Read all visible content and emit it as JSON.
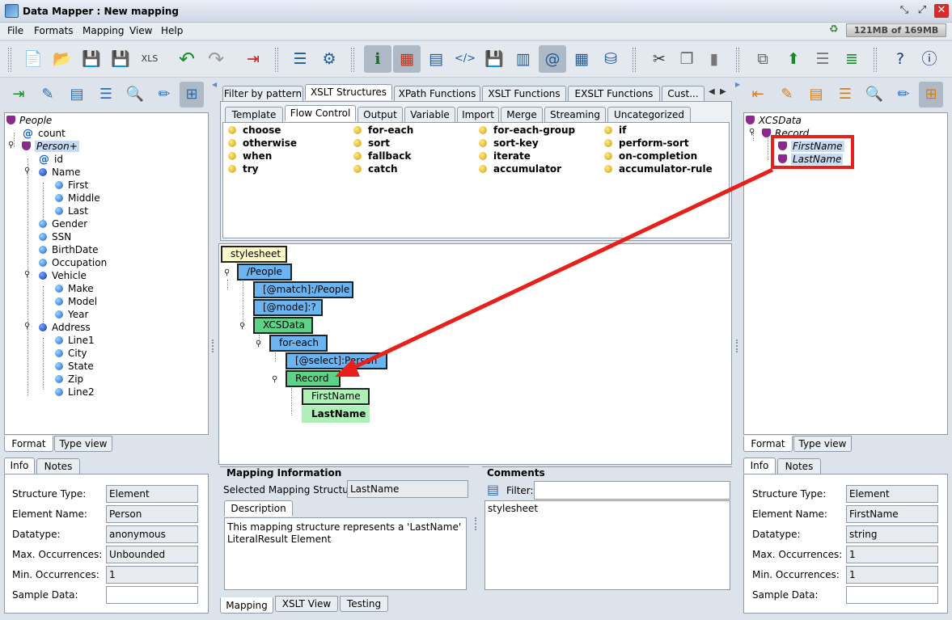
{
  "window": {
    "title": "Data Mapper : New mapping"
  },
  "menu": [
    "File",
    "Formats",
    "Mapping",
    "View",
    "Help"
  ],
  "memory": "121MB of 169MB",
  "toolbar_icons": [
    "new-mapping-icon",
    "open-icon",
    "save-icon",
    "save-as-icon",
    "export-xls-icon",
    "undo-icon",
    "redo-icon",
    "exit-icon",
    "generate-icon",
    "settings-icon",
    "info-icon",
    "palette-icon",
    "list-icon",
    "code-icon",
    "save-transform-icon",
    "document-icon",
    "at-icon",
    "table-icon",
    "database-icon",
    "cut-icon",
    "copy-icon",
    "paste-icon",
    "move-icon",
    "upload-icon",
    "align-icon",
    "stack-icon",
    "help-icon",
    "about-icon"
  ],
  "left_tree": {
    "items": [
      {
        "label": "People",
        "icon": "shield-icon"
      },
      {
        "label": "count",
        "icon": "attribute-icon"
      },
      {
        "label": "Person+",
        "icon": "shield-icon"
      },
      {
        "label": "id",
        "icon": "attribute-icon"
      },
      {
        "label": "Name",
        "icon": "element-icon"
      },
      {
        "label": "First",
        "icon": "element-icon"
      },
      {
        "label": "Middle",
        "icon": "element-icon"
      },
      {
        "label": "Last",
        "icon": "element-icon"
      },
      {
        "label": "Gender",
        "icon": "element-icon"
      },
      {
        "label": "SSN",
        "icon": "element-icon"
      },
      {
        "label": "BirthDate",
        "icon": "element-icon"
      },
      {
        "label": "Occupation",
        "icon": "element-icon"
      },
      {
        "label": "Vehicle",
        "icon": "element-icon"
      },
      {
        "label": "Make",
        "icon": "element-icon"
      },
      {
        "label": "Model",
        "icon": "element-icon"
      },
      {
        "label": "Year",
        "icon": "element-icon"
      },
      {
        "label": "Address",
        "icon": "element-icon"
      },
      {
        "label": "Line1",
        "icon": "element-icon"
      },
      {
        "label": "City",
        "icon": "element-icon"
      },
      {
        "label": "State",
        "icon": "element-icon"
      },
      {
        "label": "Zip",
        "icon": "element-icon"
      },
      {
        "label": "Line2",
        "icon": "element-icon"
      }
    ],
    "tabs": [
      "Format",
      "Type view"
    ]
  },
  "left_info": {
    "tabs": [
      "Info",
      "Notes"
    ],
    "labels": [
      "Structure Type:",
      "Element Name:",
      "Datatype:",
      "Max. Occurrences:",
      "Min. Occurrences:",
      "Sample Data:"
    ],
    "values": [
      "Element",
      "Person",
      "anonymous",
      "Unbounded",
      "1",
      ""
    ]
  },
  "center": {
    "top_tabs": [
      "Filter by pattern",
      "XSLT Structures",
      "XPath Functions",
      "XSLT Functions",
      "EXSLT Functions",
      "Cust..."
    ],
    "sub_tabs": [
      "Template",
      "Flow Control",
      "Output",
      "Variable",
      "Import",
      "Merge",
      "Streaming",
      "Uncategorized"
    ],
    "flow_items": [
      [
        "choose",
        "otherwise",
        "when",
        "try"
      ],
      [
        "for-each",
        "sort",
        "fallback",
        "catch"
      ],
      [
        "for-each-group",
        "sort-key",
        "iterate",
        "accumulator"
      ],
      [
        "if",
        "perform-sort",
        "on-completion",
        "accumulator-rule"
      ]
    ],
    "nodes": [
      "stylesheet",
      "/People",
      "[@match]:/People",
      "[@mode]:?",
      "XCSData",
      "for-each",
      "[@select]:Person",
      "Record",
      "FirstName",
      "LastName"
    ],
    "mapping_info": {
      "title": "Mapping Information",
      "selected_label": "Selected Mapping Structure:",
      "selected_value": "LastName",
      "desc_tab": "Description",
      "description": "This mapping structure represents a 'LastName' LiteralResult Element"
    },
    "comments": {
      "title": "Comments",
      "filter_label": "Filter:",
      "text": "stylesheet"
    },
    "bottom_tabs": [
      "Mapping",
      "XSLT View",
      "Testing"
    ]
  },
  "right_tree": {
    "items": [
      {
        "label": "XCSData",
        "icon": "shield-icon"
      },
      {
        "label": "Record",
        "icon": "shield-icon"
      },
      {
        "label": "FirstName",
        "icon": "shield-icon"
      },
      {
        "label": "LastName",
        "icon": "shield-icon"
      }
    ],
    "tabs": [
      "Format",
      "Type view"
    ]
  },
  "right_info": {
    "tabs": [
      "Info",
      "Notes"
    ],
    "labels": [
      "Structure Type:",
      "Element Name:",
      "Datatype:",
      "Max. Occurrences:",
      "Min. Occurrences:",
      "Sample Data:"
    ],
    "values": [
      "Element",
      "FirstName",
      "string",
      "1",
      "1",
      ""
    ]
  },
  "colors": {
    "highlight_box": "#e8201c",
    "arrow": "#e8201c",
    "node_blue": "#6cb4f0",
    "node_green": "#5fd189"
  }
}
